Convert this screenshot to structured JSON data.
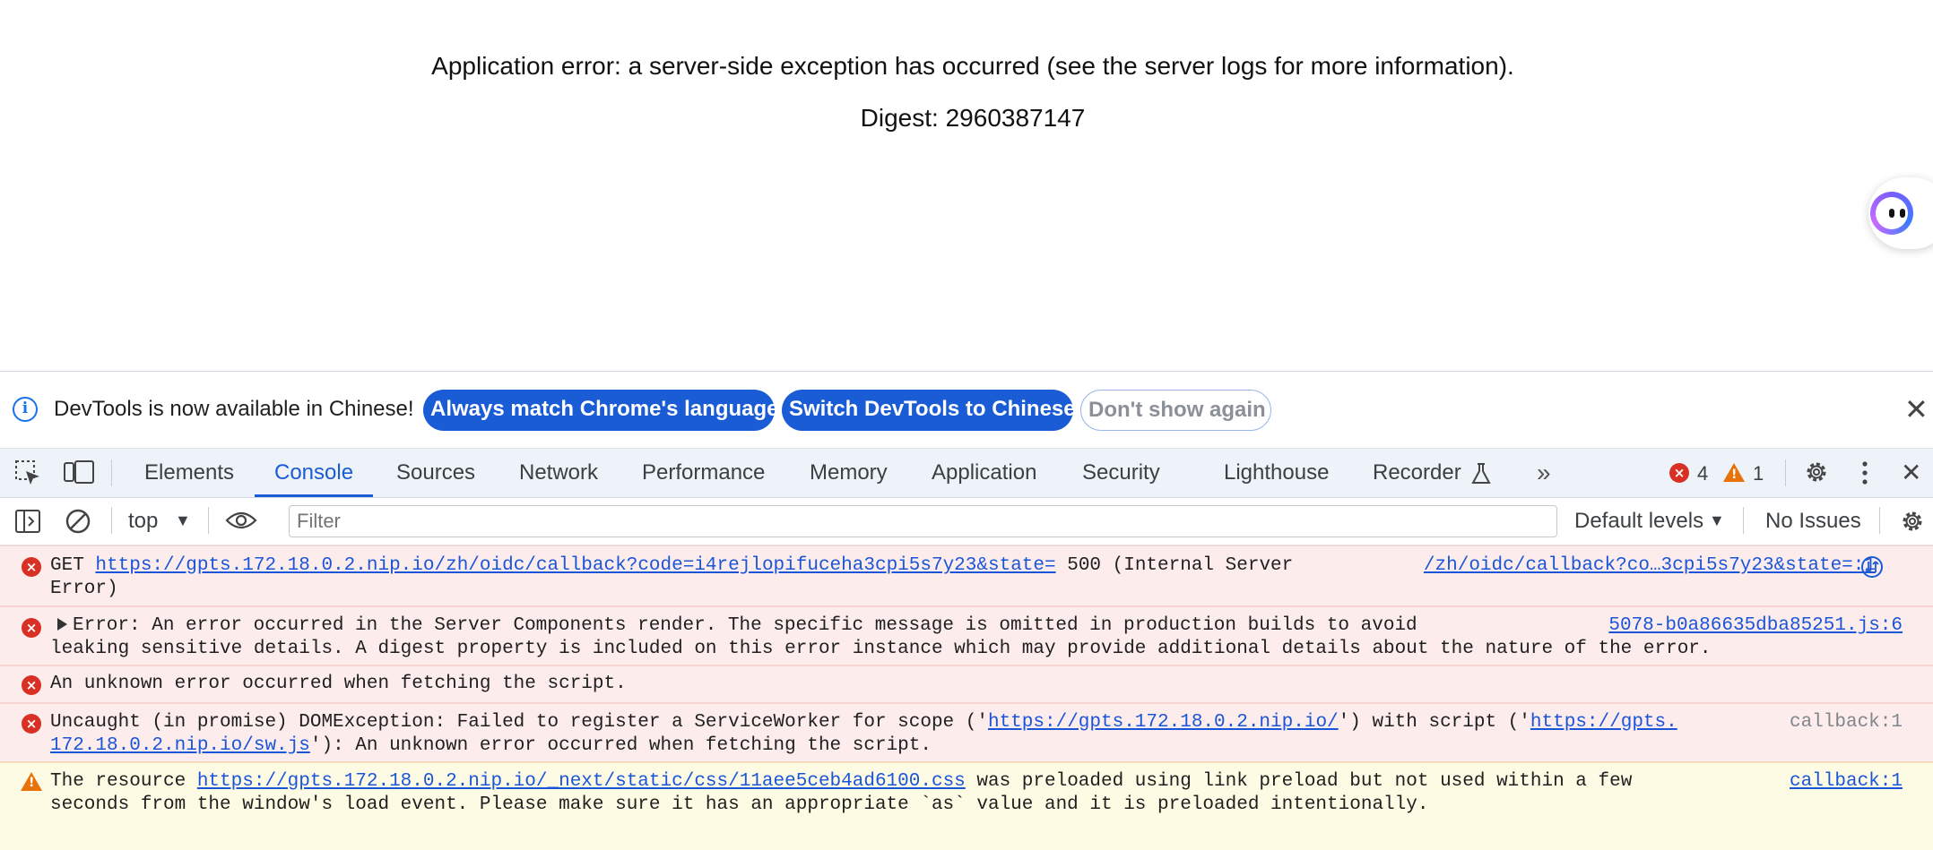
{
  "page": {
    "error_title": "Application error: a server-side exception has occurred (see the server logs for more information).",
    "digest": "Digest: 2960387147"
  },
  "devtools": {
    "infobar": {
      "text": "DevTools is now available in Chinese!",
      "btn_match": "Always match Chrome's language",
      "btn_switch": "Switch DevTools to Chinese",
      "btn_dismiss": "Don't show again"
    },
    "tabs": [
      "Elements",
      "Console",
      "Sources",
      "Network",
      "Performance",
      "Memory",
      "Application",
      "Security",
      "Lighthouse",
      "Recorder"
    ],
    "active_tab": "Console",
    "error_count": "4",
    "warning_count": "1",
    "toolbar": {
      "context": "top",
      "filter_placeholder": "Filter",
      "levels": "Default levels",
      "issues": "No Issues"
    },
    "messages": [
      {
        "level": "error",
        "l1_prefix": "GET ",
        "l1_link": "https://gpts.172.18.0.2.nip.io/zh/oidc/callback?code=i4rejlopifuceha3cpi5s7y23&state=",
        "l1_suffix": " 500 (Internal Server",
        "l2": "Error)",
        "source": "/zh/oidc/callback?co…3cpi5s7y23&state=:1"
      },
      {
        "level": "error",
        "l1": "Error: An error occurred in the Server Components render. The specific message is omitted in production builds to avoid",
        "l2": "leaking sensitive details. A digest property is included on this error instance which may provide additional details about the nature of the error.",
        "source": "5078-b0a86635dba85251.js:6"
      },
      {
        "level": "error",
        "l1": "An unknown error occurred when fetching the script."
      },
      {
        "level": "error",
        "l1_prefix": "Uncaught (in promise) DOMException: Failed to register a ServiceWorker for scope ('",
        "l1_link": "https://gpts.172.18.0.2.nip.io/",
        "l1_mid": "') with script ('",
        "l1_link2": "https://gpts.",
        "l2_link": "172.18.0.2.nip.io/sw.js",
        "l2_suffix": "'): An unknown error occurred when fetching the script.",
        "source": "callback:1"
      },
      {
        "level": "warning",
        "l1_prefix": "The resource ",
        "l1_link": "https://gpts.172.18.0.2.nip.io/_next/static/css/11aee5ceb4ad6100.css",
        "l1_suffix": " was preloaded using link preload but not used within a few",
        "l2": "seconds from the window's load event. Please make sure it has an appropriate `as` value and it is preloaded intentionally.",
        "source": "callback:1"
      }
    ]
  }
}
